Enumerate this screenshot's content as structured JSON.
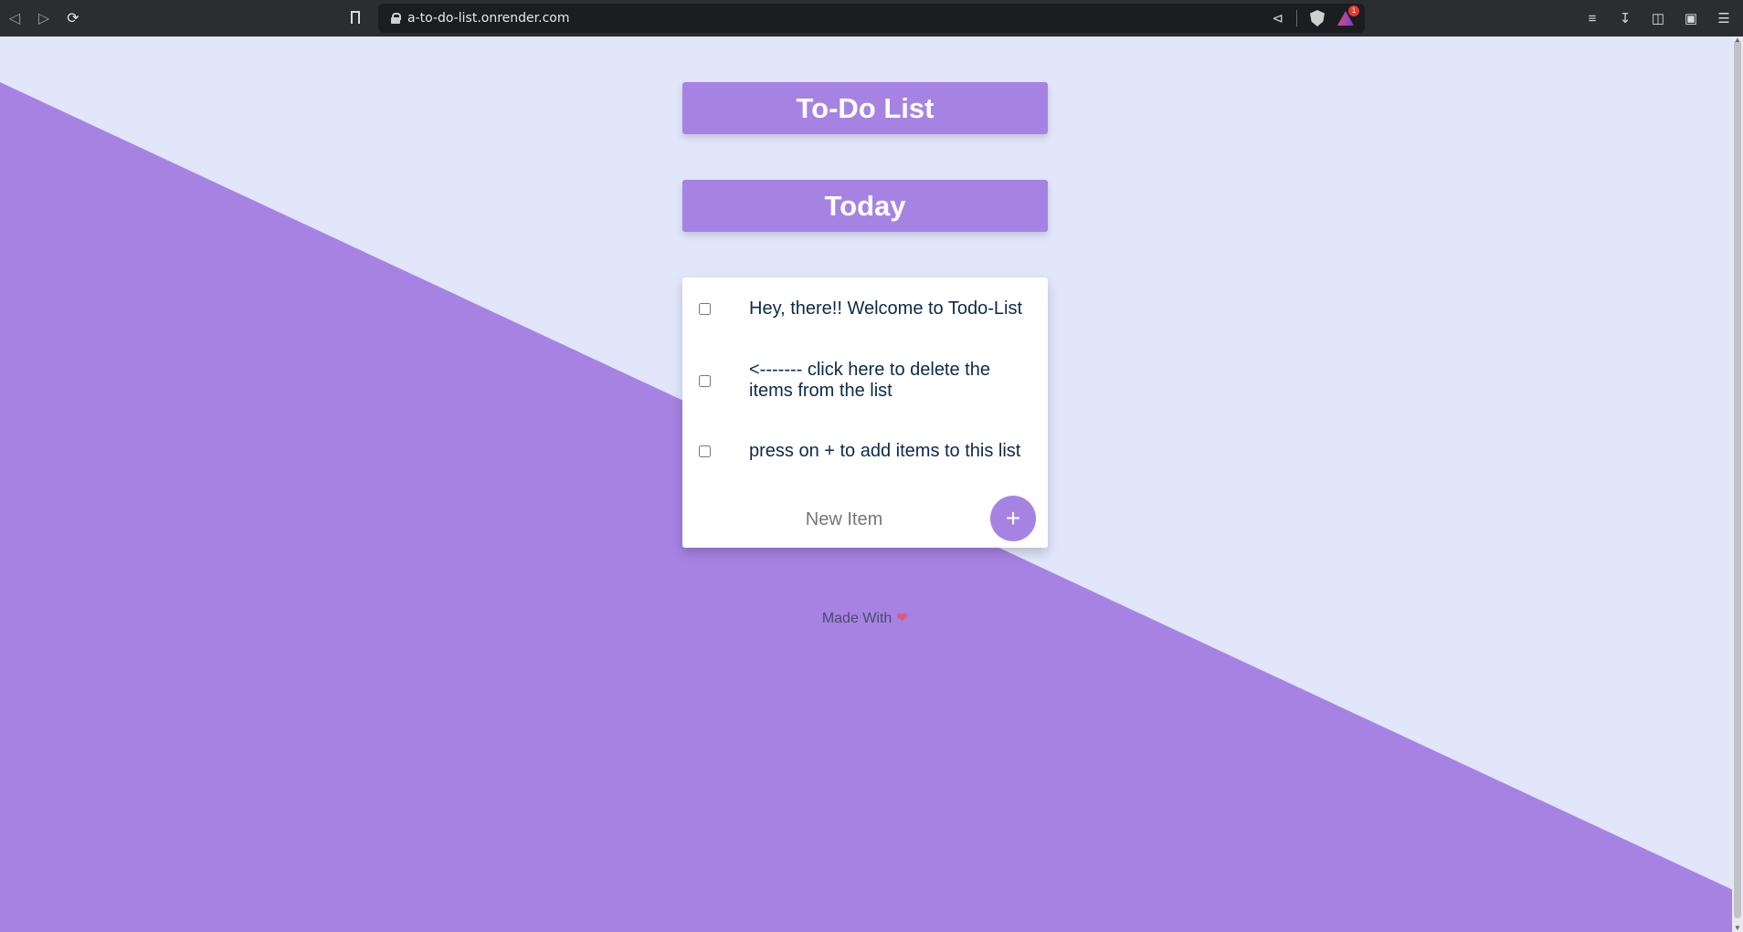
{
  "browser": {
    "url": "a-to-do-list.onrender.com",
    "notification_count": "1"
  },
  "page": {
    "title": "To-Do List",
    "day": "Today",
    "items": [
      {
        "text": "Hey, there!! Welcome to Todo-List",
        "checked": false
      },
      {
        "text": "<------- click here to delete the items from the list",
        "checked": false
      },
      {
        "text": "press on + to add items to this list",
        "checked": false
      }
    ],
    "new_item_placeholder": "New Item",
    "add_button_label": "+",
    "footer_text": "Made With",
    "footer_icon": "heart-icon"
  },
  "colors": {
    "accent": "#a683e3",
    "background_light": "#e2e6fb",
    "item_text": "#0b2a4a"
  }
}
